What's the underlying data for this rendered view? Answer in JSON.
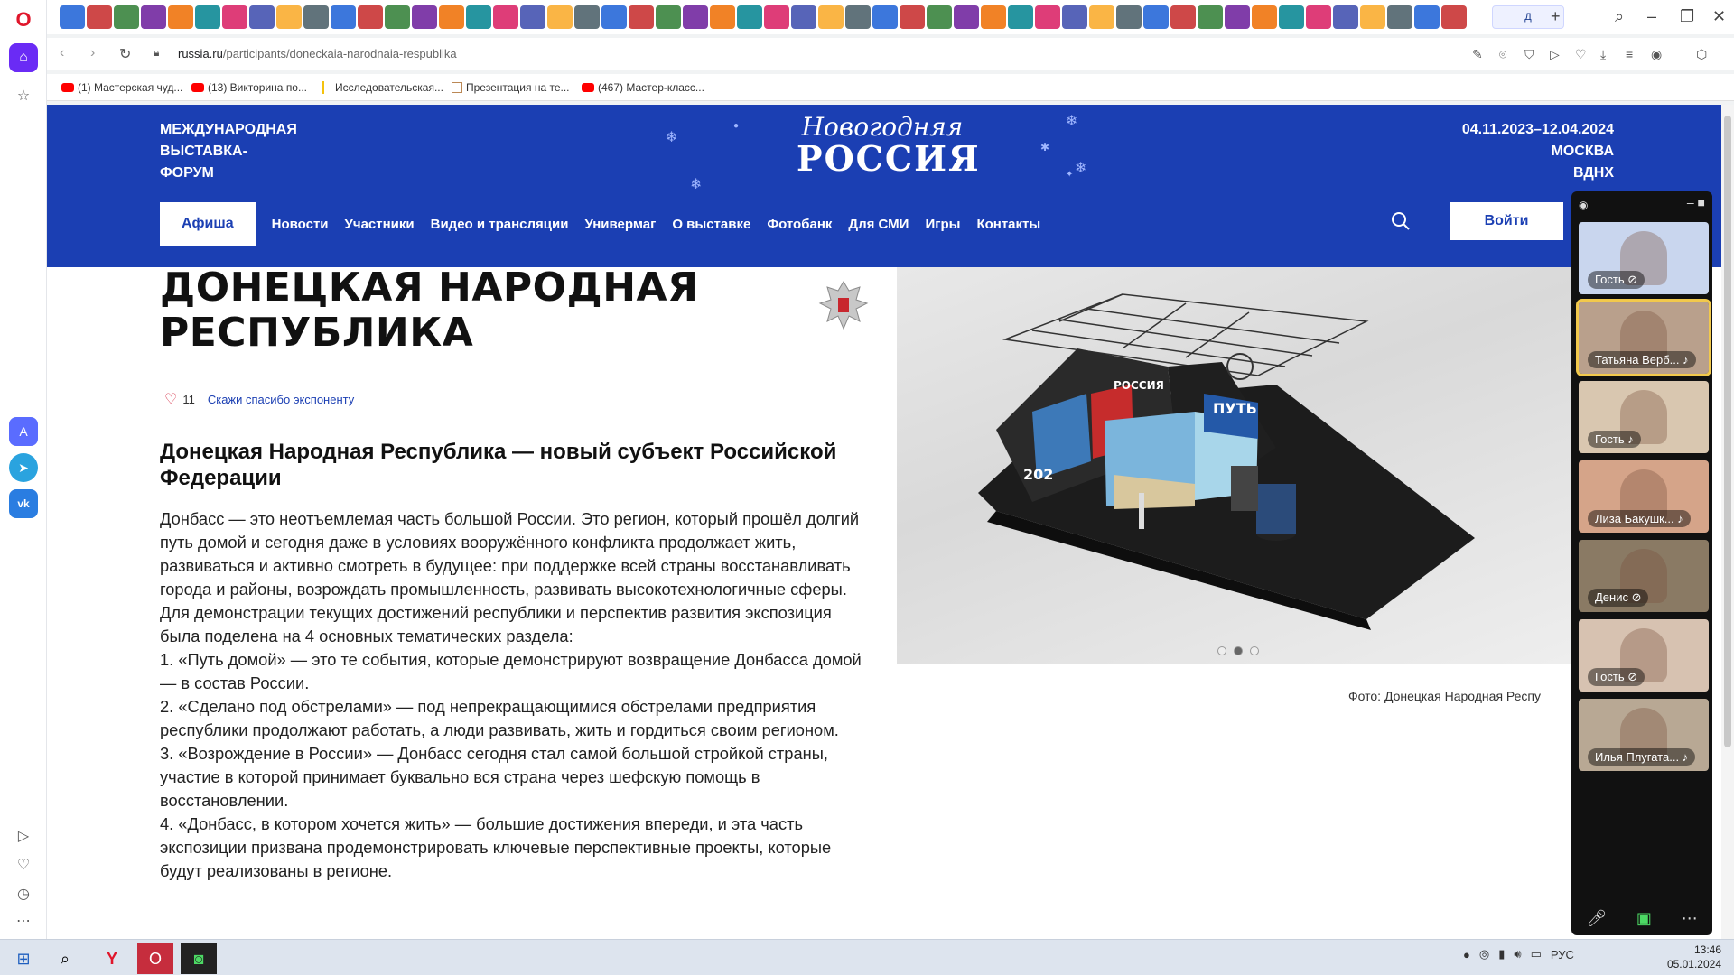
{
  "browser": {
    "url_domain": "russia.ru",
    "url_path": "/participants/doneckaia-narodnaia-respublika",
    "active_tab_label": "Д",
    "bookmarks": [
      {
        "label": "(1) Мастерская чуд...",
        "icon": "youtube-icon"
      },
      {
        "label": "(13) Викторина по...",
        "icon": "youtube-icon"
      },
      {
        "label": "Исследовательская...",
        "icon": "folder-icon"
      },
      {
        "label": "Презентация на те...",
        "icon": "presentation-icon"
      },
      {
        "label": "(467) Мастер-класс...",
        "icon": "youtube-icon"
      }
    ]
  },
  "site": {
    "brand_left": [
      "МЕЖДУНАРОДНАЯ",
      "ВЫСТАВКА-",
      "ФОРУМ"
    ],
    "logo_top": "Новогодняя",
    "logo_bottom": "РОССИЯ",
    "dates": "04.11.2023–12.04.2024",
    "city": "МОСКВА",
    "venue": "ВДНХ",
    "nav": [
      "Афиша",
      "Новости",
      "Участники",
      "Видео и трансляции",
      "Универмаг",
      "О выставке",
      "Фотобанк",
      "Для СМИ",
      "Игры",
      "Контакты"
    ],
    "login": "Войти"
  },
  "article": {
    "title_line1": "ДОНЕЦКАЯ НАРОДНАЯ",
    "title_line2": "РЕСПУБЛИКА",
    "likes": "11",
    "thanks": "Скажи спасибо экспоненту",
    "subtitle": "Донецкая Народная Республика — новый субъект Российской Федерации",
    "paragraphs": [
      "Донбасс — это неотъемлемая часть большой России. Это регион, который прошёл долгий путь домой и сегодня даже в условиях вооружённого конфликта продолжает жить, развиваться и активно смотреть в будущее: при поддержке всей страны восстанавливать города и районы, возрождать промышленность, развивать высокотехнологичные сферы.",
      "Для демонстрации текущих достижений республики и перспектив развития экспозиция была поделена на 4 основных тематических раздела:",
      "1. «Путь домой» — это те события, которые демонстрируют возвращение Донбасса домой — в состав России.",
      "2. «Сделано под обстрелами» — под непрекращающимися обстрелами предприятия республики продолжают работать, а люди развивать, жить и гордиться своим регионом.",
      "3. «Возрождение в России» — Донбасс сегодня стал самой большой стройкой страны, участие в которой принимает буквально вся страна через шефскую помощь в восстановлении.",
      "4. «Донбасс, в котором хочется жить» — большие достижения впереди, и эта часть экспозиции призвана продемонстрировать ключевые перспективные проекты, которые будут реализованы в регионе."
    ],
    "photo_caption": "Фото: Донецкая Народная Респу",
    "photo_sign_1": "РОССИЯ",
    "photo_sign_2": "ПУТЬ",
    "photo_sign_3": "202",
    "carousel_active": 2
  },
  "call": {
    "participants": [
      {
        "name": "Гость",
        "muted": true,
        "bg": "#c9d6ee"
      },
      {
        "name": "Татьяна Верб...",
        "muted": false,
        "bg": "#b9a08c",
        "speaking": true
      },
      {
        "name": "Гость",
        "muted": false,
        "bg": "#d9c7b0"
      },
      {
        "name": "Лиза Бакушк...",
        "muted": false,
        "bg": "#d5a489"
      },
      {
        "name": "Денис",
        "muted": true,
        "bg": "#8a7a64"
      },
      {
        "name": "Гость",
        "muted": true,
        "bg": "#d7c2b1"
      },
      {
        "name": "Илья Плугата...",
        "muted": false,
        "bg": "#b8a894"
      }
    ]
  },
  "taskbar": {
    "lang": "РУС",
    "time": "13:46",
    "date": "05.01.2024"
  }
}
